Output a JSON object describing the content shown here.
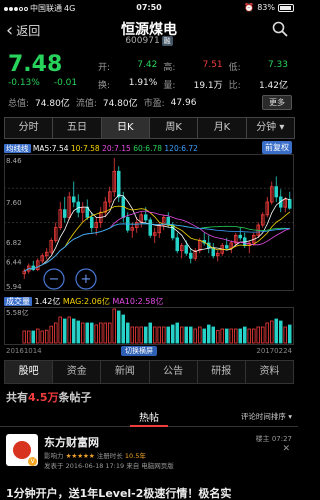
{
  "status": {
    "carrier": "中国联通",
    "network": "4G",
    "time": "07:50",
    "battery": "83%"
  },
  "header": {
    "back": "返回",
    "title": "恒源煤电",
    "code": "600971",
    "rong_tag": "融"
  },
  "quote": {
    "price": "7.48",
    "change_pct": "-0.13%",
    "change": "-0.01",
    "open_k": "开:",
    "open_v": "7.42",
    "high_k": "高:",
    "high_v": "7.51",
    "low_k": "低:",
    "low_v": "7.33",
    "turnover_k": "换:",
    "turnover_v": "1.91%",
    "volume_k": "量:",
    "volume_v": "19.1万",
    "ratio_k": "比:",
    "ratio_v": "1.42亿",
    "total_cap_k": "总值:",
    "total_cap_v": "74.80亿",
    "float_cap_k": "流值:",
    "float_cap_v": "74.80亿",
    "pe_k": "市盈:",
    "pe_v": "47.96",
    "more": "更多"
  },
  "period_tabs": [
    "分时",
    "五日",
    "日K",
    "周K",
    "月K",
    "分钟"
  ],
  "period_active": 2,
  "ma": {
    "tag": "均线线",
    "ma5": "MA5:7.54",
    "ma10": "10:7.58",
    "ma20": "20:7.15",
    "ma60": "60:6.78",
    "ma120": "120:6.72",
    "fq": "前复权"
  },
  "kchart_axis": {
    "high": "8.46",
    "mid1": "7.60",
    "mid2": "6.82",
    "mid3": "6.44",
    "low": "5.94"
  },
  "volume": {
    "tag": "成交量",
    "vol": "1.42亿",
    "mag": "MAG:2.06亿",
    "ma10": "MA10:2.58亿",
    "axis_top": "5.58亿"
  },
  "dates": {
    "start": "20161014",
    "end": "20170224"
  },
  "fullscreen": "切换横屏",
  "bottom_tabs": [
    "股吧",
    "资金",
    "新闻",
    "公告",
    "研报",
    "资料"
  ],
  "bottom_active": 0,
  "posts": {
    "prefix": "共有",
    "count": "4.5万",
    "suffix": "条帖子"
  },
  "subtab": {
    "hot": "热帖",
    "sort": "评论时间排序"
  },
  "post": {
    "user": "东方财富网",
    "rank_prefix": "影响力",
    "stars": "★★★★★",
    "rank_suffix": "注册时长",
    "age": "10.5年",
    "floor": "楼主 07:27",
    "time": "发表于 2016-06-18 17:19  来自 电脑网页版",
    "text": "1分钟开户，送1年Level-2极速行情！极名实",
    "close": "✕"
  },
  "chart_data": [
    {
      "type": "candlestick",
      "x": [
        "20161014",
        "20170224"
      ],
      "ylim": [
        5.94,
        8.46
      ],
      "y_ticks": [
        8.46,
        7.6,
        6.82,
        6.44,
        5.94
      ],
      "series": [
        {
          "name": "MA5",
          "color": "#ffffff",
          "last": 7.54
        },
        {
          "name": "10",
          "color": "#f5d400",
          "last": 7.58
        },
        {
          "name": "20",
          "color": "#e64ce6",
          "last": 7.15
        },
        {
          "name": "60",
          "color": "#27d35b",
          "last": 6.78
        },
        {
          "name": "120",
          "color": "#3aa0ff",
          "last": 6.72
        }
      ],
      "candles": [
        [
          6.2,
          6.3,
          6.1,
          6.25
        ],
        [
          6.25,
          6.4,
          6.2,
          6.35
        ],
        [
          6.35,
          6.45,
          6.25,
          6.28
        ],
        [
          6.28,
          6.5,
          6.25,
          6.45
        ],
        [
          6.45,
          6.6,
          6.4,
          6.55
        ],
        [
          6.55,
          6.7,
          6.48,
          6.62
        ],
        [
          6.62,
          6.9,
          6.58,
          6.85
        ],
        [
          6.85,
          7.2,
          6.8,
          7.1
        ],
        [
          7.1,
          7.6,
          7.05,
          7.45
        ],
        [
          7.45,
          7.7,
          7.2,
          7.3
        ],
        [
          7.3,
          7.8,
          7.25,
          7.7
        ],
        [
          7.7,
          8.0,
          7.5,
          7.6
        ],
        [
          7.6,
          7.75,
          7.3,
          7.4
        ],
        [
          7.4,
          7.6,
          7.2,
          7.5
        ],
        [
          7.5,
          7.65,
          7.25,
          7.3
        ],
        [
          7.3,
          7.4,
          7.0,
          7.1
        ],
        [
          7.1,
          7.3,
          6.95,
          7.2
        ],
        [
          7.2,
          7.5,
          7.1,
          7.4
        ],
        [
          7.4,
          7.7,
          7.3,
          7.6
        ],
        [
          7.6,
          7.9,
          7.5,
          7.8
        ],
        [
          7.8,
          8.46,
          7.7,
          8.2
        ],
        [
          8.2,
          8.3,
          7.6,
          7.7
        ],
        [
          7.7,
          7.8,
          7.2,
          7.3
        ],
        [
          7.3,
          7.4,
          7.0,
          7.05
        ],
        [
          7.05,
          7.2,
          6.9,
          7.1
        ],
        [
          7.1,
          7.3,
          7.0,
          7.2
        ],
        [
          7.2,
          7.4,
          7.1,
          7.35
        ],
        [
          7.35,
          7.5,
          7.2,
          7.25
        ],
        [
          7.25,
          7.3,
          6.9,
          6.95
        ],
        [
          6.95,
          7.1,
          6.8,
          7.0
        ],
        [
          7.0,
          7.2,
          6.9,
          7.15
        ],
        [
          7.15,
          7.35,
          7.05,
          7.3
        ],
        [
          7.3,
          7.4,
          7.1,
          7.15
        ],
        [
          7.15,
          7.2,
          6.85,
          6.9
        ],
        [
          6.9,
          7.0,
          6.6,
          6.65
        ],
        [
          6.65,
          6.8,
          6.5,
          6.75
        ],
        [
          6.75,
          6.85,
          6.55,
          6.6
        ],
        [
          6.6,
          6.7,
          6.4,
          6.5
        ],
        [
          6.5,
          6.7,
          6.45,
          6.65
        ],
        [
          6.65,
          6.9,
          6.6,
          6.85
        ],
        [
          6.85,
          7.0,
          6.75,
          6.8
        ],
        [
          6.8,
          6.95,
          6.6,
          6.7
        ],
        [
          6.7,
          6.8,
          6.5,
          6.55
        ],
        [
          6.55,
          6.65,
          6.44,
          6.6
        ],
        [
          6.6,
          6.8,
          6.55,
          6.75
        ],
        [
          6.75,
          6.9,
          6.65,
          6.7
        ],
        [
          6.7,
          6.85,
          6.6,
          6.8
        ],
        [
          6.8,
          7.0,
          6.75,
          6.95
        ],
        [
          6.95,
          7.1,
          6.85,
          6.9
        ],
        [
          6.9,
          7.0,
          6.7,
          6.75
        ],
        [
          6.75,
          6.85,
          6.6,
          6.8
        ],
        [
          6.8,
          7.0,
          6.75,
          6.95
        ],
        [
          6.95,
          7.2,
          6.9,
          7.15
        ],
        [
          7.15,
          7.4,
          7.1,
          7.35
        ],
        [
          7.35,
          7.7,
          7.3,
          7.6
        ],
        [
          7.6,
          8.0,
          7.55,
          7.9
        ],
        [
          7.9,
          8.1,
          7.6,
          7.7
        ],
        [
          7.7,
          7.85,
          7.4,
          7.5
        ],
        [
          7.5,
          7.7,
          7.4,
          7.65
        ],
        [
          7.65,
          7.8,
          7.45,
          7.48
        ]
      ]
    }
  ]
}
